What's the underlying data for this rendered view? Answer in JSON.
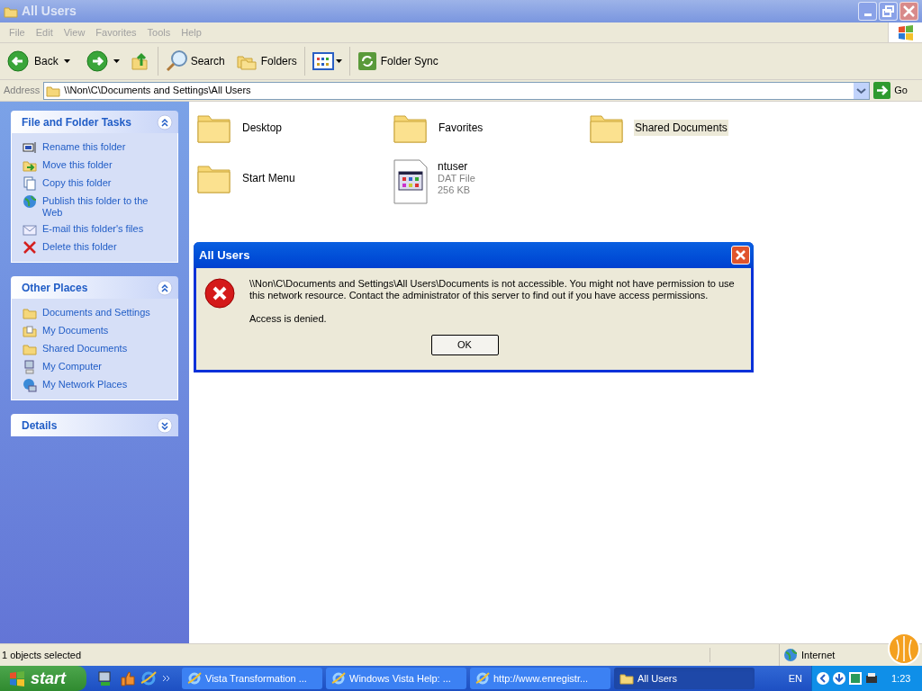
{
  "window": {
    "title": "All Users"
  },
  "menu": [
    "File",
    "Edit",
    "View",
    "Favorites",
    "Tools",
    "Help"
  ],
  "toolbar": {
    "back": "Back",
    "search": "Search",
    "folders": "Folders",
    "folder_sync": "Folder Sync"
  },
  "address": {
    "label": "Address",
    "value": "\\\\Non\\C\\Documents and Settings\\All Users",
    "go": "Go"
  },
  "sidebar": [
    {
      "title": "File and Folder Tasks",
      "expanded": true,
      "items": [
        "Rename this folder",
        "Move this folder",
        "Copy this folder",
        "Publish this folder to the Web",
        "E-mail this folder's files",
        "Delete this folder"
      ]
    },
    {
      "title": "Other Places",
      "expanded": true,
      "items": [
        "Documents and Settings",
        "My Documents",
        "Shared Documents",
        "My Computer",
        "My Network Places"
      ]
    },
    {
      "title": "Details",
      "expanded": false
    }
  ],
  "files": [
    {
      "kind": "folder",
      "name": "Desktop",
      "selected": false
    },
    {
      "kind": "folder",
      "name": "Favorites",
      "selected": false
    },
    {
      "kind": "folder",
      "name": "Shared Documents",
      "selected": true
    },
    {
      "kind": "folder",
      "name": "Start Menu",
      "selected": false
    },
    {
      "kind": "file",
      "name": "ntuser",
      "type": "DAT File",
      "size": "256 KB",
      "selected": false
    }
  ],
  "dialog": {
    "title": "All Users",
    "message": "\\\\Non\\C\\Documents and Settings\\All Users\\Documents is not accessible. You might not have permission to use this network resource. Contact the administrator of this server to find out if you have access permissions.",
    "detail": "Access is denied.",
    "button": "OK"
  },
  "status_bar": {
    "text": "1 objects selected",
    "zone": "Internet"
  },
  "taskbar": {
    "start": "start",
    "buttons": [
      {
        "label": "Vista Transformation ...",
        "selected": false
      },
      {
        "label": "Windows Vista Help: ...",
        "selected": false
      },
      {
        "label": "http://www.enregistr...",
        "selected": false
      },
      {
        "label": "All Users",
        "selected": true
      }
    ],
    "language": "EN",
    "clock": "1:23"
  }
}
